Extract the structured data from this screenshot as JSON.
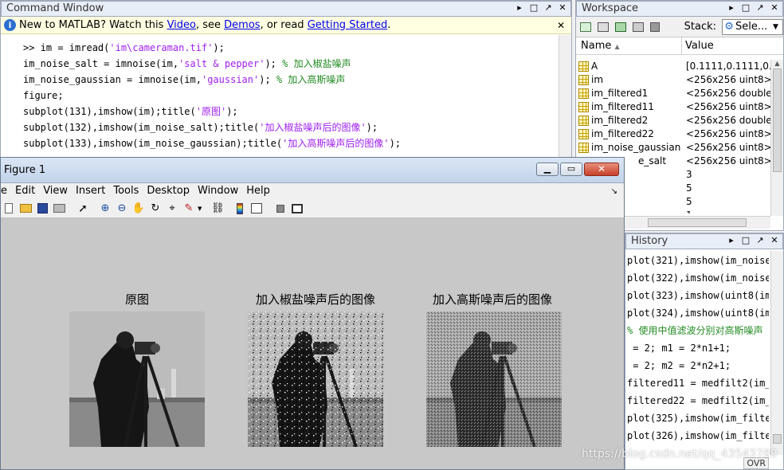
{
  "command_window": {
    "title": "Command Window",
    "banner": {
      "prefix": "New to MATLAB? Watch this ",
      "video": "Video",
      "see": ", see ",
      "demos": "Demos",
      "or_read": ", or read ",
      "getting_started": "Getting Started",
      "period": "."
    },
    "lines": [
      {
        "pre": ">> im = imread(",
        "str": "'im\\cameraman.tif'",
        "post": ");",
        "cmt": ""
      },
      {
        "pre": "im_noise_salt = imnoise(im,",
        "str": "'salt & pepper'",
        "post": "); ",
        "cmt": "% 加入椒盐噪声"
      },
      {
        "pre": "im_noise_gaussian = imnoise(im,",
        "str": "'gaussian'",
        "post": "); ",
        "cmt": "% 加入高斯噪声"
      },
      {
        "pre": "figure;",
        "str": "",
        "post": "",
        "cmt": ""
      },
      {
        "pre": "subplot(131),imshow(im);title(",
        "str": "'原图'",
        "post": ");",
        "cmt": ""
      },
      {
        "pre": "subplot(132),imshow(im_noise_salt);title(",
        "str": "'加入椒盐噪声后的图像'",
        "post": ");",
        "cmt": ""
      },
      {
        "pre": "subplot(133),imshow(im_noise_gaussian);title(",
        "str": "'加入高斯噪声后的图像'",
        "post": ");",
        "cmt": ""
      }
    ]
  },
  "workspace": {
    "title": "Workspace",
    "stack_label": "Stack:",
    "stack_value": "Sele...",
    "col_name": "Name",
    "col_value": "Value",
    "rows": [
      {
        "name": "A",
        "value": "[0.1111,0.1111,0.11"
      },
      {
        "name": "im",
        "value": "<256x256 uint8>"
      },
      {
        "name": "im_filtered1",
        "value": "<256x256 double>"
      },
      {
        "name": "im_filtered11",
        "value": "<256x256 uint8>"
      },
      {
        "name": "im_filtered2",
        "value": "<256x256 double>"
      },
      {
        "name": "im_filtered22",
        "value": "<256x256 uint8>"
      },
      {
        "name": "im_noise_gaussian",
        "value": "<256x256 uint8>"
      },
      {
        "name": "e_salt",
        "value": "<256x256 uint8>"
      },
      {
        "name": "",
        "value": "3"
      },
      {
        "name": "",
        "value": "5"
      },
      {
        "name": "",
        "value": "5"
      },
      {
        "name": "",
        "value": "1"
      }
    ]
  },
  "history": {
    "title": "History",
    "lines": [
      {
        "text": "plot(321),imshow(im_noise_",
        "cmt": false
      },
      {
        "text": "plot(322),imshow(im_noise_",
        "cmt": false
      },
      {
        "text": "plot(323),imshow(uint8(im_",
        "cmt": false
      },
      {
        "text": "plot(324),imshow(uint8(im_",
        "cmt": false
      },
      {
        "text": "% 使用中值滤波分别对高斯噪声",
        "cmt": true
      },
      {
        "text": " = 2; m1 = 2*n1+1;",
        "cmt": false
      },
      {
        "text": " = 2; m2 = 2*n2+1;",
        "cmt": false
      },
      {
        "text": "filtered11 = medfilt2(im_n",
        "cmt": false
      },
      {
        "text": "filtered22 = medfilt2(im_n",
        "cmt": false
      },
      {
        "text": "plot(325),imshow(im_filter",
        "cmt": false
      },
      {
        "text": "plot(326),imshow(im_filter",
        "cmt": false
      }
    ]
  },
  "figure": {
    "title": "Figure 1",
    "menus": [
      "e",
      "Edit",
      "View",
      "Insert",
      "Tools",
      "Desktop",
      "Window",
      "Help"
    ],
    "subplots": [
      {
        "title": "原图"
      },
      {
        "title": "加入椒盐噪声后的图像"
      },
      {
        "title": "加入高斯噪声后的图像"
      }
    ]
  },
  "status": {
    "ovr": "OVR"
  },
  "watermark": "https://blog.csdn.net/qq_43543789"
}
